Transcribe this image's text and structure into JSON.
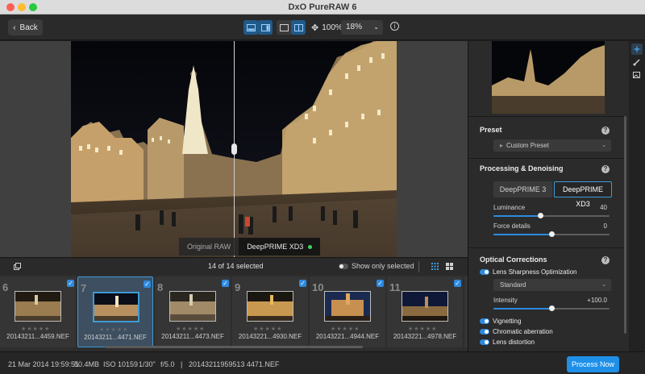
{
  "window": {
    "title": "DxO PureRAW 6"
  },
  "toolbar": {
    "back_label": "Back",
    "zoom_fit": "100%",
    "zoom_value": "18%"
  },
  "viewer": {
    "label_original": "Original RAW",
    "label_processed": "DeepPRIME XD3"
  },
  "filmstrip": {
    "selected_count": "14 of 14 selected",
    "show_only_label": "Show only selected",
    "stars": "★★★★★",
    "thumbs": [
      {
        "num": "6",
        "name": "20143211...4459.NEF",
        "selected": false
      },
      {
        "num": "7",
        "name": "20143211...4471.NEF",
        "selected": true
      },
      {
        "num": "8",
        "name": "20143211...4473.NEF",
        "selected": false
      },
      {
        "num": "9",
        "name": "20143221...4930.NEF",
        "selected": false
      },
      {
        "num": "10",
        "name": "20143221...4944.NEF",
        "selected": false
      },
      {
        "num": "11",
        "name": "20143221...4978.NEF",
        "selected": false
      }
    ]
  },
  "status": {
    "date": "21 Mar 2014 19:59:51",
    "size": "50.4MB",
    "iso": "ISO 10159",
    "shutter": "1/30\"",
    "aperture": "f/5.0",
    "sep": "|",
    "filename": "20143211959513 4471.NEF",
    "process_label": "Process Now"
  },
  "panel": {
    "preset": {
      "title": "Preset",
      "value": "Custom Preset"
    },
    "processing": {
      "title": "Processing & Denoising",
      "option_a": "DeepPRIME 3",
      "option_b": "DeepPRIME XD3",
      "luminance_label": "Luminance",
      "luminance_value": "40",
      "luminance_level": 0.4,
      "force_label": "Force details",
      "force_value": "0",
      "force_level": 0.5
    },
    "optical": {
      "title": "Optical Corrections",
      "lens_sharpness_label": "Lens Sharpness Optimization",
      "sharpness_mode": "Standard",
      "intensity_label": "Intensity",
      "intensity_value": "+100.0",
      "intensity_level": 0.5,
      "vignetting_label": "Vignetting",
      "chromatic_label": "Chromatic aberration",
      "distortion_label": "Lens distortion"
    }
  },
  "colors": {
    "accent": "#2d8ae0",
    "process_button": "#1e90e8"
  }
}
